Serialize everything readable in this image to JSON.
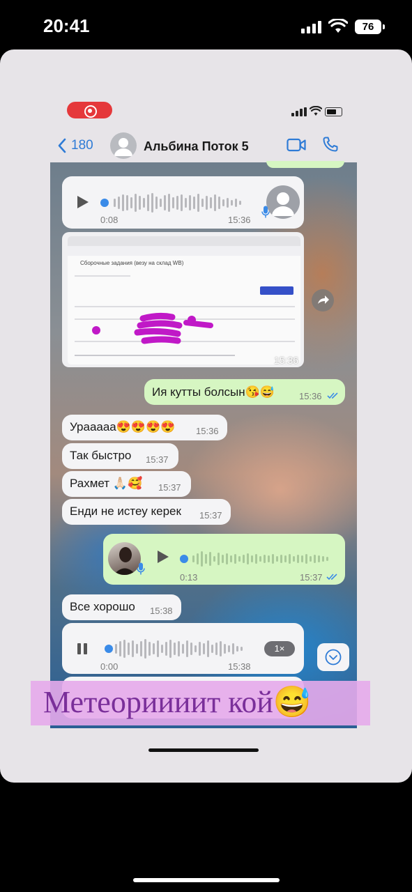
{
  "outer_status": {
    "time": "20:41",
    "battery": "76"
  },
  "chat_header": {
    "back_count": "180",
    "contact_name": "Альбина Поток 5"
  },
  "messages": [
    {
      "kind": "voice_in",
      "duration": "0:08",
      "time": "15:36"
    },
    {
      "kind": "image_in",
      "time": "15:36",
      "image_title": "Сборочные задания (везу на склад WB)"
    },
    {
      "kind": "text_out",
      "text": "Ия кутты болсын😘😅",
      "time": "15:36"
    },
    {
      "kind": "text_in",
      "text": "Урааааа😍😍😍😍",
      "time": "15:36"
    },
    {
      "kind": "text_in",
      "text": "Так быстро",
      "time": "15:37"
    },
    {
      "kind": "text_in",
      "text": "Рахмет 🙏🏻🥰",
      "time": "15:37"
    },
    {
      "kind": "text_in",
      "text": "Енди не истеу керек",
      "time": "15:37"
    },
    {
      "kind": "voice_out",
      "duration": "0:13",
      "time": "15:37"
    },
    {
      "kind": "text_in",
      "text": "Все хорошо",
      "time": "15:38"
    },
    {
      "kind": "voice_in_playing",
      "duration": "0:00",
      "time": "15:38",
      "speed": "1×"
    }
  ],
  "caption": "Метеориииит кой😅",
  "colors": {
    "incoming_bubble": "#f4f4f6",
    "outgoing_bubble": "#d6f6c2",
    "accent_blue": "#2e7bd6",
    "caption_bg": "#e6aaeb",
    "caption_text": "#7a2f9a",
    "record_pill": "#e5383b"
  },
  "icons": [
    "play-icon",
    "pause-icon",
    "mic-icon",
    "video-call-icon",
    "phone-icon",
    "share-icon",
    "scroll-down-icon",
    "back-chevron-icon",
    "read-ticks-icon"
  ]
}
